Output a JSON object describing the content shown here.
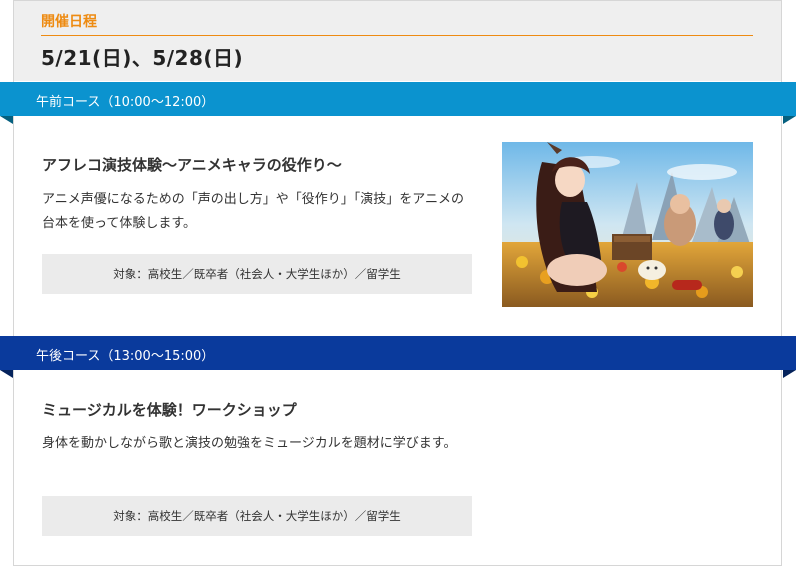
{
  "schedule": {
    "label": "開催日程",
    "dates": "5/21(日)、5/28(日)"
  },
  "courses": [
    {
      "band": "午前コース（10:00〜12:00）",
      "title": "アフレコ演技体験〜アニメキャラの役作り〜",
      "description": "アニメ声優になるための「声の出し方」や「役作り」「演技」をアニメの台本を使って体験します。",
      "target": "対象：高校生／既卒者（社会人・大学生ほか）／留学生",
      "band_color": "#0b93cf"
    },
    {
      "band": "午後コース（13:00〜15:00）",
      "title": "ミュージカルを体験！ワークショップ",
      "description": "身体を動かしながら歌と演技の勉強をミュージカルを題材に学びます。",
      "target": "対象：高校生／既卒者（社会人・大学生ほか）／留学生",
      "band_color": "#0a3a9c"
    }
  ],
  "colors": {
    "accent_orange": "#ee8b12"
  }
}
